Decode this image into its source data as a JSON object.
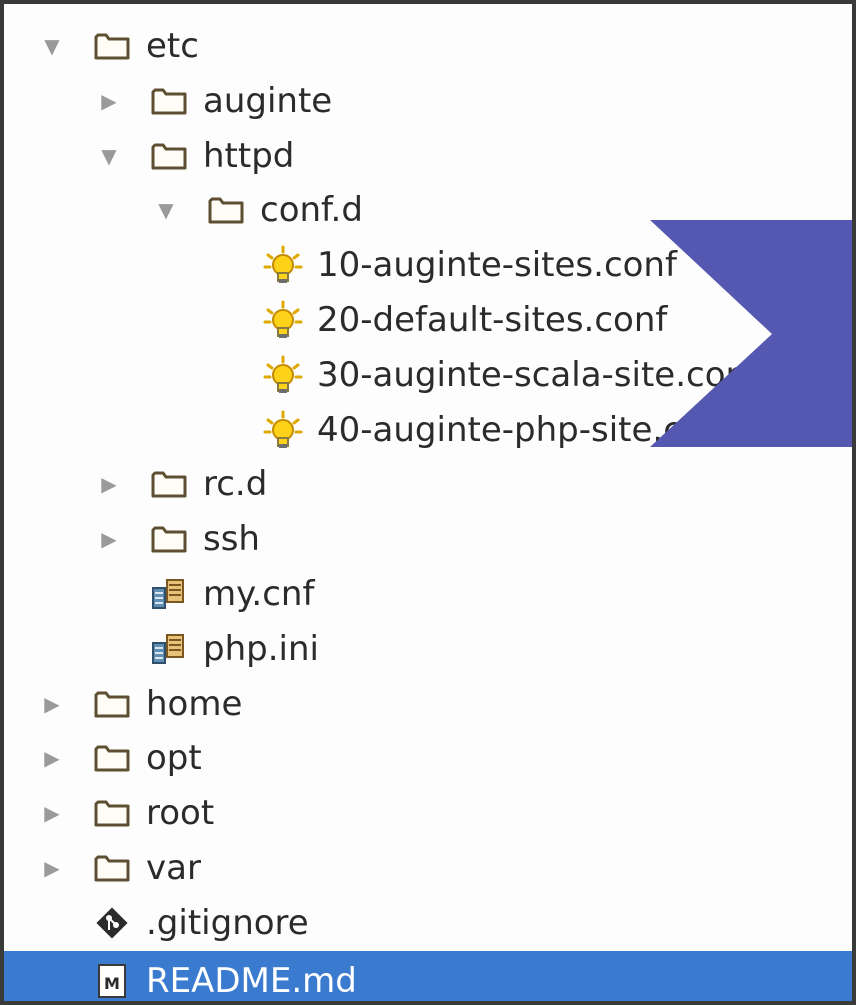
{
  "tree": {
    "items": [
      {
        "label": "etc",
        "type": "folder",
        "expanded": true,
        "level": 0
      },
      {
        "label": "auginte",
        "type": "folder",
        "expanded": false,
        "level": 1
      },
      {
        "label": "httpd",
        "type": "folder",
        "expanded": true,
        "level": 1
      },
      {
        "label": "conf.d",
        "type": "folder",
        "expanded": true,
        "level": 2
      },
      {
        "label": "10-auginte-sites.conf",
        "type": "conf-file",
        "level": 3
      },
      {
        "label": "20-default-sites.conf",
        "type": "conf-file",
        "level": 3
      },
      {
        "label": "30-auginte-scala-site.conf",
        "type": "conf-file",
        "level": 3
      },
      {
        "label": "40-auginte-php-site.conf",
        "type": "conf-file",
        "level": 3
      },
      {
        "label": "rc.d",
        "type": "folder",
        "expanded": false,
        "level": 1
      },
      {
        "label": "ssh",
        "type": "folder",
        "expanded": false,
        "level": 1
      },
      {
        "label": "my.cnf",
        "type": "config-file",
        "level": 1
      },
      {
        "label": "php.ini",
        "type": "config-file",
        "level": 1
      },
      {
        "label": "home",
        "type": "folder",
        "expanded": false,
        "level": 0
      },
      {
        "label": "opt",
        "type": "folder",
        "expanded": false,
        "level": 0
      },
      {
        "label": "root",
        "type": "folder",
        "expanded": false,
        "level": 0
      },
      {
        "label": "var",
        "type": "folder",
        "expanded": false,
        "level": 0
      },
      {
        "label": ".gitignore",
        "type": "git-file",
        "level": 0
      },
      {
        "label": "README.md",
        "type": "markdown-file",
        "level": 0,
        "selected": true
      }
    ]
  },
  "colors": {
    "selection": "#3a7bd0",
    "folder": "#6b5a3a",
    "arrow": "#9a9a9a",
    "overlay": "#5558b0"
  },
  "icons": {
    "folder": "folder-icon",
    "conf-file": "lightbulb-icon",
    "config-file": "config-file-icon",
    "git-file": "git-icon",
    "markdown-file": "markdown-icon",
    "expanded": "triangle-down-icon",
    "collapsed": "triangle-right-icon"
  }
}
